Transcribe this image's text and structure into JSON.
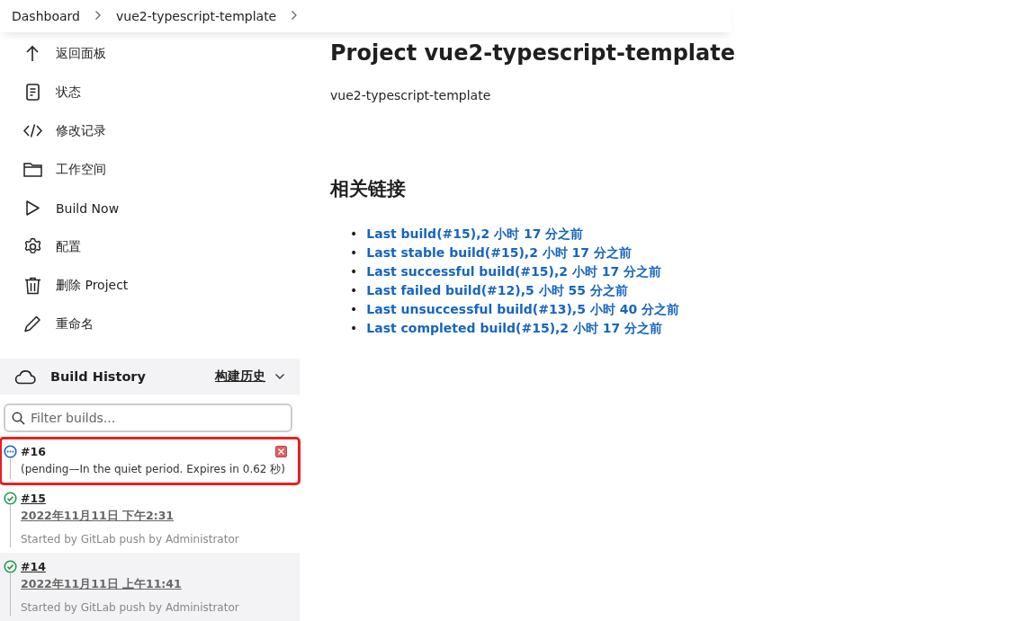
{
  "breadcrumbs": [
    {
      "label": "Dashboard"
    },
    {
      "label": "vue2-typescript-template"
    }
  ],
  "sidebar": {
    "items": [
      {
        "kind": "up",
        "label": "返回面板"
      },
      {
        "kind": "doc",
        "label": "状态"
      },
      {
        "kind": "code",
        "label": "修改记录"
      },
      {
        "kind": "folder",
        "label": "工作空间"
      },
      {
        "kind": "play",
        "label": "Build Now"
      },
      {
        "kind": "gear",
        "label": "配置"
      },
      {
        "kind": "trash",
        "label": "删除 Project"
      },
      {
        "kind": "pencil",
        "label": "重命名"
      }
    ]
  },
  "build_history": {
    "title": "Build History",
    "trend_link": "构建历史",
    "filter": {
      "placeholder": "Filter builds..."
    },
    "builds": [
      {
        "kind": "pending",
        "number": "#16",
        "highlighted": true,
        "hovered": false,
        "detail": "(pending—In the quiet period. Expires in 0.62 秒)"
      },
      {
        "kind": "success",
        "number": "#15",
        "highlighted": false,
        "hovered": false,
        "date": "2022年11月11日 下午2:31",
        "cause": "Started by GitLab push by Administrator"
      },
      {
        "kind": "success",
        "number": "#14",
        "highlighted": false,
        "hovered": true,
        "date": "2022年11月11日 上午11:41",
        "cause": "Started by GitLab push by Administrator"
      }
    ]
  },
  "main": {
    "title": "Project vue2-typescript-template",
    "description": "vue2-typescript-template",
    "links_heading": "相关链接",
    "links": [
      {
        "marker": "•",
        "label": "Last build(#15),2 小时 17 分之前"
      },
      {
        "marker": "•",
        "label": "Last stable build(#15),2 小时 17 分之前"
      },
      {
        "marker": "•",
        "label": "Last successful build(#15),2 小时 17 分之前"
      },
      {
        "marker": "•",
        "label": "Last failed build(#12),5 小时 55 分之前"
      },
      {
        "marker": "•",
        "label": "Last unsuccessful build(#13),5 小时 40 分之前"
      },
      {
        "marker": "•",
        "label": "Last completed build(#15),2 小时 17 分之前"
      }
    ]
  }
}
